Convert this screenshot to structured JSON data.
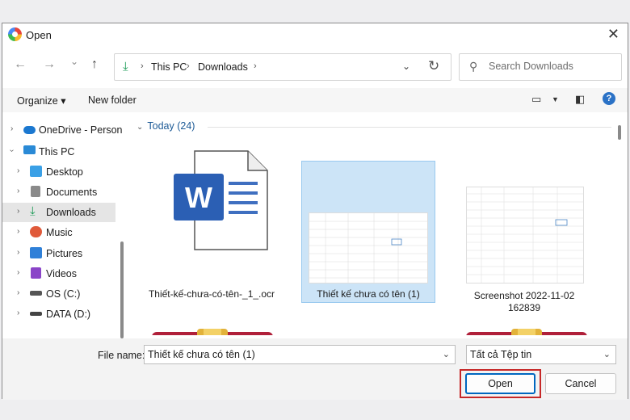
{
  "window": {
    "title": "Open"
  },
  "nav": {
    "back": "←",
    "forward": "→",
    "recent": "⌄",
    "up": "↑",
    "breadcrumb": [
      "This PC",
      "Downloads"
    ],
    "search_placeholder": "Search Downloads"
  },
  "toolbar": {
    "organize": "Organize ▾",
    "new_folder": "New folder",
    "help": "?"
  },
  "sidebar": {
    "items": [
      {
        "label": "OneDrive - Person",
        "icon": "cloud-icon",
        "color": "#1b78d0",
        "expanded": false,
        "indent": 1
      },
      {
        "label": "This PC",
        "icon": "monitor-icon",
        "color": "#2a8ad6",
        "expanded": true,
        "indent": 1
      },
      {
        "label": "Desktop",
        "icon": "desktop-icon",
        "color": "#3aa0e6",
        "expanded": false,
        "indent": 2
      },
      {
        "label": "Documents",
        "icon": "documents-icon",
        "color": "#7a7a7a",
        "expanded": false,
        "indent": 2
      },
      {
        "label": "Downloads",
        "icon": "download-icon",
        "color": "#1a9a56",
        "expanded": false,
        "indent": 2,
        "selected": true
      },
      {
        "label": "Music",
        "icon": "music-icon",
        "color": "#e05a3a",
        "expanded": false,
        "indent": 2
      },
      {
        "label": "Pictures",
        "icon": "pictures-icon",
        "color": "#2f80d8",
        "expanded": false,
        "indent": 2
      },
      {
        "label": "Videos",
        "icon": "videos-icon",
        "color": "#8a44c8",
        "expanded": false,
        "indent": 2
      },
      {
        "label": "OS (C:)",
        "icon": "drive-icon",
        "color": "#555555",
        "expanded": false,
        "indent": 2
      },
      {
        "label": "DATA (D:)",
        "icon": "drive-icon",
        "color": "#444444",
        "expanded": false,
        "indent": 2
      }
    ]
  },
  "content": {
    "group": "Today (24)",
    "files": [
      {
        "name": "Thiết-kế-chưa-có-tên-_1_.ocr",
        "type": "word-doc"
      },
      {
        "name": "Thiết kế chưa có tên (1)",
        "type": "spreadsheet-image",
        "selected": true
      },
      {
        "name": "Screenshot 2022-11-02 162839",
        "type": "spreadsheet-image"
      },
      {
        "name": "",
        "type": "archive"
      },
      {
        "name": "",
        "type": "archive"
      }
    ]
  },
  "footer": {
    "file_name_label": "File name:",
    "file_name_value": "Thiết kế chưa có tên (1)",
    "file_type_value": "Tất cả Tệp tin",
    "open_label": "Open",
    "cancel_label": "Cancel"
  },
  "colors": {
    "accent": "#0067c0",
    "selection": "#cce4f7",
    "highlight_box": "#c62828",
    "folder_header": "#1c5a96"
  }
}
